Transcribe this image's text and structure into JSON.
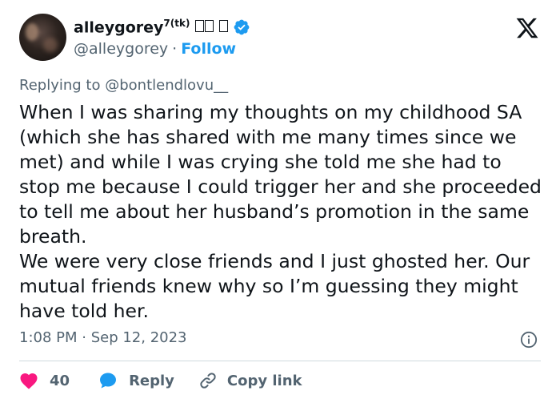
{
  "author": {
    "display_name": "alleygorey",
    "display_name_suffix": "7(tk)",
    "handle": "@alleygorey",
    "follow_label": "Follow",
    "separator": "·"
  },
  "reply": {
    "prefix": "Replying to",
    "target": "@bontlendlovu__"
  },
  "tweet": {
    "paragraphs": [
      "When I was sharing my thoughts on my childhood SA (which she has shared with me many times since we met) and while I was crying she told me she had to stop me because I could trigger her and she proceeded to tell me about her husband’s promotion in the same breath.",
      "We were very close friends and I just ghosted her. Our mutual friends knew why so I’m guessing they might have told her."
    ],
    "timestamp": "1:08 PM · Sep 12, 2023"
  },
  "actions": {
    "like_count": "40",
    "reply_label": "Reply",
    "copy_link_label": "Copy link"
  },
  "icons": {
    "like": "heart-icon",
    "reply": "speech-bubble-icon",
    "copy_link": "link-icon",
    "info": "info-icon",
    "verified": "verified-badge-icon",
    "platform": "x-logo-icon"
  },
  "colors": {
    "accent": "#1d9bf0",
    "like": "#f91880",
    "text": "#0f1419",
    "muted": "#536471",
    "divider": "#cfd9de"
  }
}
